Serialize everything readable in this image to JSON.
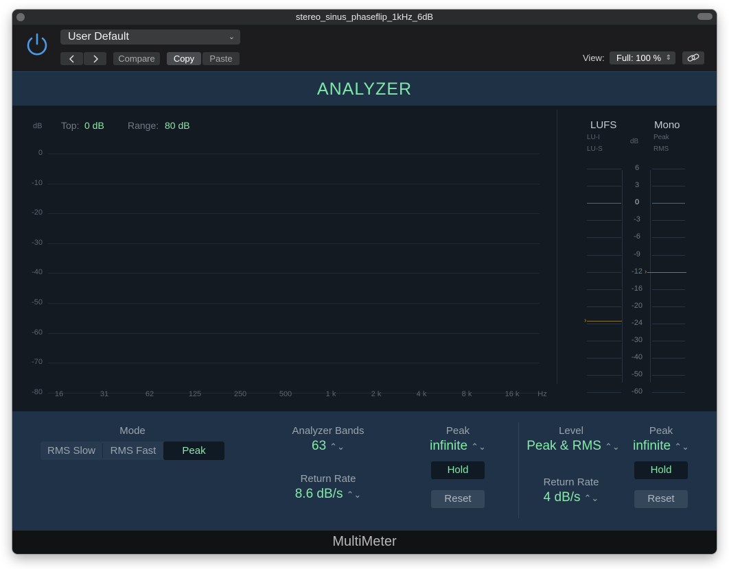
{
  "window": {
    "title": "stereo_sinus_phaseflip_1kHz_6dB"
  },
  "header": {
    "preset": "User Default",
    "compare_label": "Compare",
    "copy_label": "Copy",
    "paste_label": "Paste",
    "view_label": "View:",
    "view_value": "Full: 100 %",
    "icons": [
      "power-icon",
      "chevron-left-icon",
      "chevron-right-icon",
      "link-icon"
    ]
  },
  "banner": {
    "title": "ANALYZER"
  },
  "analyzer": {
    "unit_label": "dB",
    "top_label": "Top:",
    "top_value": "0 dB",
    "range_label": "Range:",
    "range_value": "80 dB",
    "y_ticks": [
      "0",
      "-10",
      "-20",
      "-30",
      "-40",
      "-50",
      "-60",
      "-70",
      "-80"
    ],
    "x_ticks": [
      "16",
      "31",
      "62",
      "125",
      "250",
      "500",
      "1 k",
      "2 k",
      "4 k",
      "8 k",
      "16 k"
    ],
    "x_unit": "Hz"
  },
  "meters": {
    "lufs_header": "LUFS",
    "mono_header": "Mono",
    "lufs_sub": [
      "LU-I",
      "LU-S"
    ],
    "mono_sub": [
      "Peak",
      "RMS"
    ],
    "scale_unit": "dB",
    "scale_ticks": [
      "6",
      "3",
      "0",
      "-3",
      "-6",
      "-9",
      "-12",
      "-16",
      "-20",
      "-24",
      "-30",
      "-40",
      "-50",
      "-60"
    ],
    "lufs_pointer_db": -23.4,
    "mono_pointer_db": -12
  },
  "controls": {
    "mode_label": "Mode",
    "mode_options": [
      "RMS Slow",
      "RMS Fast",
      "Peak"
    ],
    "mode_selected": "Peak",
    "bands_label": "Analyzer Bands",
    "bands_value": "63",
    "analyzer_return_label": "Return Rate",
    "analyzer_return_value": "8.6 dB/s",
    "analyzer_peak_label": "Peak",
    "analyzer_peak_value": "infinite",
    "hold_label": "Hold",
    "reset_label": "Reset",
    "level_label": "Level",
    "level_value": "Peak & RMS",
    "level_return_label": "Return Rate",
    "level_return_value": "4 dB/s",
    "level_peak_label": "Peak",
    "level_peak_value": "infinite",
    "stepper_glyph": "⌃⌄"
  },
  "footer": {
    "title": "MultiMeter"
  },
  "colors": {
    "accent_green": "#86e8a8",
    "panel_blue": "#1f3247",
    "pointer": "#b58d3a"
  }
}
